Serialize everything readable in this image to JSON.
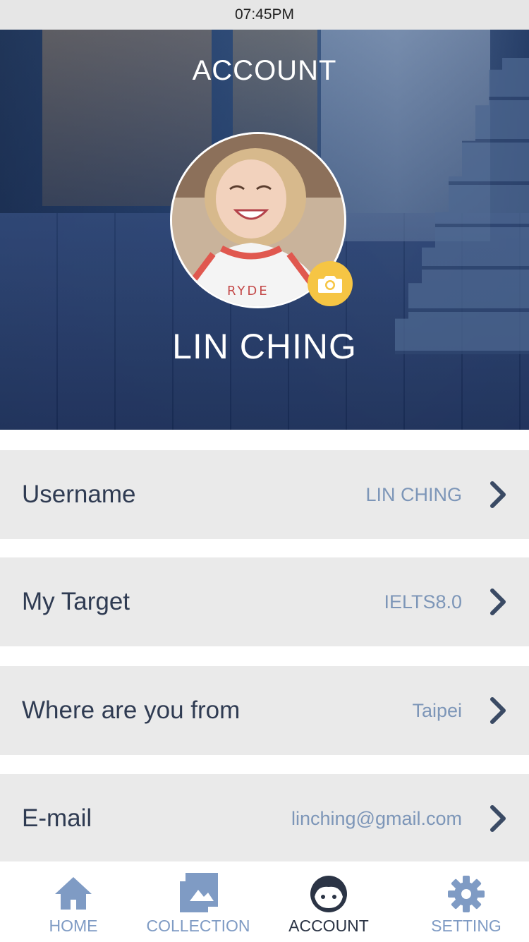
{
  "status_bar": {
    "time": "07:45PM"
  },
  "header": {
    "title": "ACCOUNT"
  },
  "profile": {
    "name": "LIN CHING"
  },
  "rows": [
    {
      "label": "Username",
      "value": "LIN CHING"
    },
    {
      "label": "My Target",
      "value": "IELTS8.0"
    },
    {
      "label": "Where are you from",
      "value": "Taipei"
    },
    {
      "label": "E-mail",
      "value": "linching@gmail.com"
    }
  ],
  "tabbar": {
    "items": [
      {
        "label": "HOME",
        "icon": "home-icon"
      },
      {
        "label": "COLLECTION",
        "icon": "gallery-icon"
      },
      {
        "label": "ACCOUNT",
        "icon": "face-icon",
        "active": true
      },
      {
        "label": "SETTING",
        "icon": "gear-icon"
      }
    ]
  },
  "colors": {
    "accent_yellow": "#f6c544",
    "row_background": "#eaeaea",
    "label_text": "#2f3b52",
    "value_text": "#7d96b8",
    "tab_inactive": "#7f9bc4",
    "tab_active": "#2b3445"
  }
}
